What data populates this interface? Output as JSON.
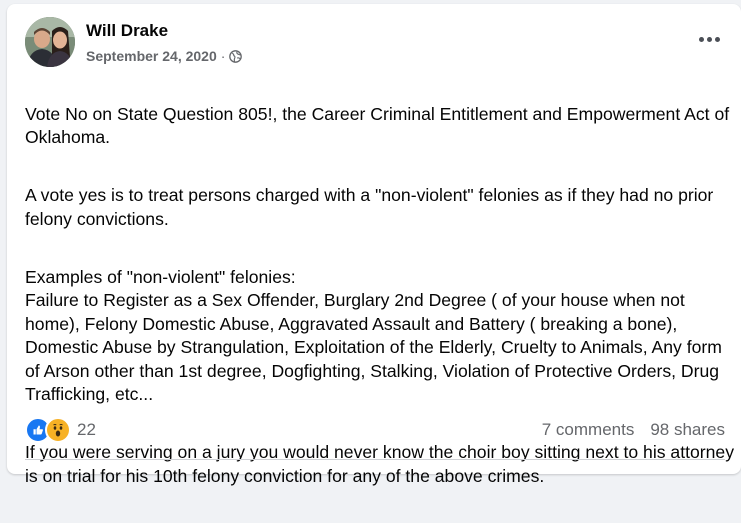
{
  "post": {
    "author": "Will Drake",
    "date": "September 24, 2020",
    "separator": "·",
    "privacy_icon": "globe-icon",
    "menu_icon": "more-options-icon",
    "paragraphs": [
      "Vote No on State Question 805!, the Career Criminal Entitlement and Empowerment Act of Oklahoma.",
      "A vote yes is to treat persons charged with a \"non-violent\" felonies  as if they had no prior felony convictions.",
      "Examples of \"non-violent\" felonies:\nFailure to Register as a Sex Offender, Burglary 2nd Degree ( of your house when not home), Felony Domestic Abuse, Aggravated Assault and Battery ( breaking a bone), Domestic Abuse by Strangulation, Exploitation of the Elderly, Cruelty to Animals, Any form of Arson other than 1st degree, Dogfighting, Stalking, Violation of Protective Orders, Drug Trafficking, etc...",
      "If you were serving on a jury you would never know the choir boy sitting next to his attorney is on trial for his 10th felony conviction for any of the above crimes."
    ]
  },
  "engagement": {
    "reaction_icons": [
      "like-icon",
      "wow-icon"
    ],
    "reaction_count": "22",
    "comments": "7 comments",
    "shares": "98 shares"
  },
  "colors": {
    "like_blue": "#1877f2",
    "wow_yellow": "#f7b125",
    "text_secondary": "#65676b",
    "text_primary": "#050505"
  }
}
